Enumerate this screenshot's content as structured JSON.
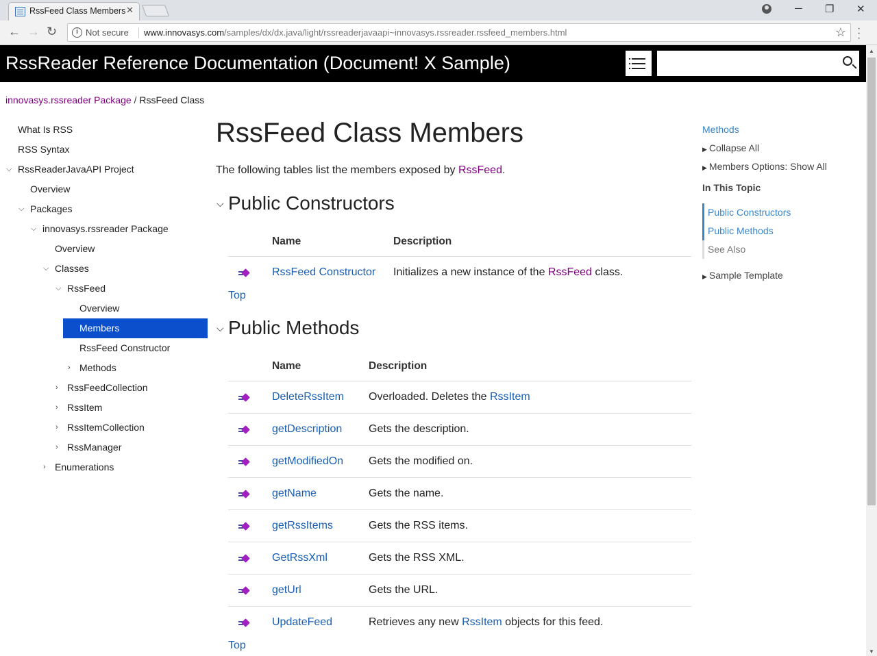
{
  "browser": {
    "tab_title": "RssFeed Class Members",
    "not_secure": "Not secure",
    "url_host": "www.innovasys.com",
    "url_path": "/samples/dx/dx.java/light/rssreaderjavaapi~innovasys.rssreader.rssfeed_members.html"
  },
  "header": {
    "title": "RssReader Reference Documentation (Document! X Sample)",
    "search_placeholder": ""
  },
  "breadcrumb": {
    "package": "innovasys.rssreader Package",
    "separator": " / ",
    "current": "RssFeed Class"
  },
  "nav": {
    "items": [
      {
        "label": "What Is RSS"
      },
      {
        "label": "RSS Syntax"
      },
      {
        "label": "RssReaderJavaAPI Project",
        "expanded": true
      },
      {
        "label": "Overview"
      },
      {
        "label": "Packages",
        "expanded": true
      },
      {
        "label": "innovasys.rssreader Package",
        "expanded": true
      },
      {
        "label": "Overview"
      },
      {
        "label": "Classes",
        "expanded": true
      },
      {
        "label": "RssFeed",
        "expanded": true
      },
      {
        "label": "Overview"
      },
      {
        "label": "Members",
        "selected": true
      },
      {
        "label": "RssFeed Constructor"
      },
      {
        "label": "Methods",
        "expanded": false
      },
      {
        "label": "RssFeedCollection",
        "expanded": false
      },
      {
        "label": "RssItem",
        "expanded": false
      },
      {
        "label": "RssItemCollection",
        "expanded": false
      },
      {
        "label": "RssManager",
        "expanded": false
      },
      {
        "label": "Enumerations",
        "expanded": false
      }
    ]
  },
  "main": {
    "heading": "RssFeed Class Members",
    "intro_prefix": "The following tables list the members exposed by ",
    "intro_link": "RssFeed",
    "intro_suffix": ".",
    "top_label": "Top",
    "col_name": "Name",
    "col_description": "Description",
    "constructors": {
      "heading": "Public Constructors",
      "rows": [
        {
          "name": "RssFeed Constructor",
          "desc_prefix": "Initializes a new instance of the ",
          "desc_link": "RssFeed",
          "desc_suffix": " class."
        }
      ]
    },
    "methods": {
      "heading": "Public Methods",
      "rows": [
        {
          "name": "DeleteRssItem",
          "desc_prefix": "Overloaded. Deletes the ",
          "desc_link": "RssItem",
          "desc_suffix": ""
        },
        {
          "name": "getDescription",
          "desc_prefix": "Gets the description.",
          "desc_link": "",
          "desc_suffix": ""
        },
        {
          "name": "getModifiedOn",
          "desc_prefix": "Gets the modified on.",
          "desc_link": "",
          "desc_suffix": ""
        },
        {
          "name": "getName",
          "desc_prefix": "Gets the name.",
          "desc_link": "",
          "desc_suffix": ""
        },
        {
          "name": "getRssItems",
          "desc_prefix": "Gets the RSS items.",
          "desc_link": "",
          "desc_suffix": ""
        },
        {
          "name": "GetRssXml",
          "desc_prefix": "Gets the RSS XML.",
          "desc_link": "",
          "desc_suffix": ""
        },
        {
          "name": "getUrl",
          "desc_prefix": "Gets the URL.",
          "desc_link": "",
          "desc_suffix": ""
        },
        {
          "name": "UpdateFeed",
          "desc_prefix": "Retrieves any new ",
          "desc_link": "RssItem",
          "desc_suffix": " objects for this feed."
        }
      ]
    }
  },
  "right_panel": {
    "methods_link": "Methods",
    "collapse_all": "Collapse All",
    "members_options": "Members Options: Show All",
    "in_this_topic": "In This Topic",
    "toc": [
      {
        "label": "Public Constructors",
        "active": true
      },
      {
        "label": "Public Methods",
        "active": true
      },
      {
        "label": "See Also",
        "active": false
      }
    ],
    "sample_template": "Sample Template"
  },
  "colors": {
    "header_bg": "#000000",
    "selected_nav": "#0b4fcc",
    "visited_link": "#800080",
    "link": "#1a5eb0",
    "toc_accent": "#3a85c8"
  }
}
